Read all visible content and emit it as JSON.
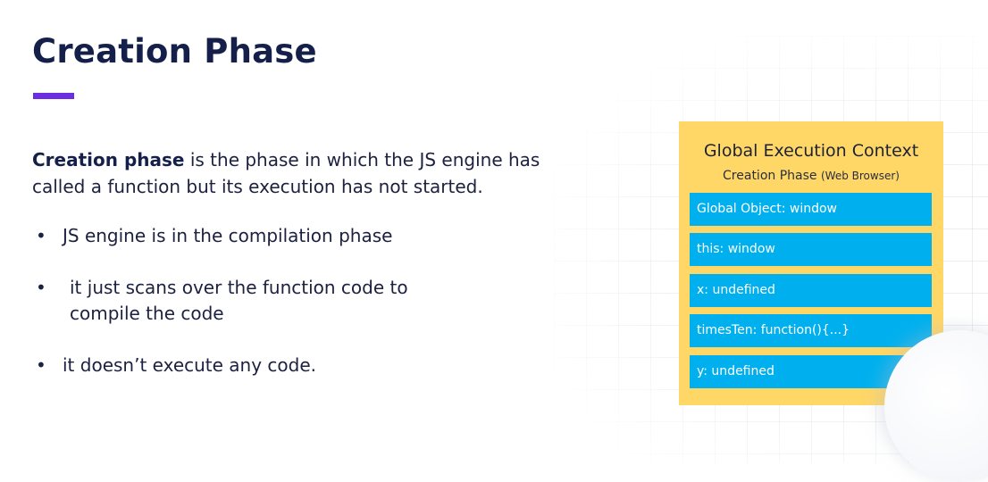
{
  "slide": {
    "title": "Creation Phase",
    "accent_color": "#6d2ee0",
    "intro": {
      "bold": "Creation phase",
      "rest_line1": " is the phase in which the JS engine has",
      "rest_line2": "called a function but its execution has not started."
    },
    "bullet_marker": "•",
    "bullets": [
      {
        "line1": "JS engine is in the compilation phase"
      },
      {
        "line1": "it just scans over the function code to",
        "line2": "compile the code"
      },
      {
        "line1": "it doesn’t execute any code."
      }
    ]
  },
  "execution_context": {
    "title": "Global Execution Context",
    "subtitle": "Creation Phase",
    "subtitle_note": "(Web Browser)",
    "box_color": "#ffd767",
    "row_color": "#00b0ee",
    "rows": [
      "Global Object: window",
      "this: window",
      "x: undefined",
      "timesTen: function(){...}",
      "y: undefined"
    ]
  }
}
